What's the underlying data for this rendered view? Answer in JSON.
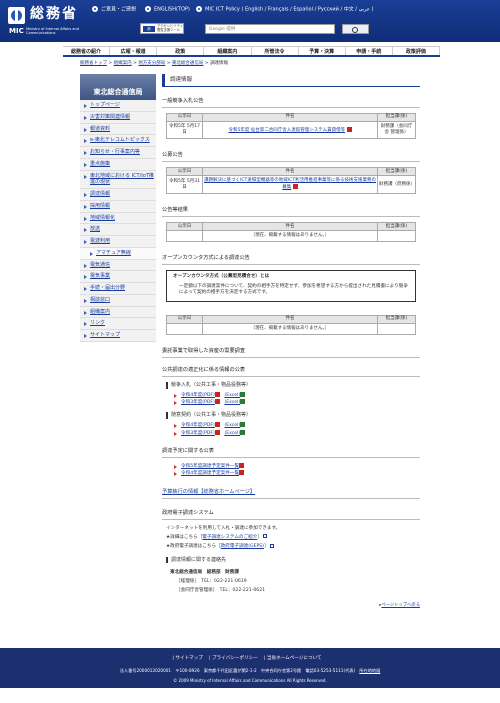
{
  "header": {
    "logo_ja": "総務省",
    "logo_mic": "MIC",
    "logo_en": "Ministry of Internal Affairs and Communications",
    "link1": "ご意見・ご感想",
    "link2": "ENGLISH(TOP)",
    "link3": "MIC ICT Policy ( English / Français / Español / Русский / 中文 / عربي )",
    "font_label": "アクセシビリティ閲覧支援ツール",
    "search_placeholder": "Google 提供"
  },
  "nav": [
    "総務省の紹介",
    "広報・報道",
    "政策",
    "組織案内",
    "所管法令",
    "予算・決算",
    "申請・手続",
    "政策評価"
  ],
  "breadcrumb": [
    "総務省トップ",
    "組織案内",
    "地方支分部局",
    "東北総合通信局",
    "調達情報"
  ],
  "sidebar": {
    "title": "東北総合通信局",
    "items": [
      "トップページ",
      "災害対策関連情報",
      "報道資料",
      "e-東北テレコムトピックス",
      "お知らせ・行事案内等",
      "重点施策",
      "東北地域における ICT/IoT推進の現状",
      "調達情報",
      "採用情報",
      "地域情報化",
      "放送",
      "電波利用",
      "アマチュア無線",
      "電気通信",
      "電気事業",
      "手続・届出分野",
      "相談窓口",
      "組織案内",
      "リンク",
      "サイトマップ"
    ]
  },
  "main": {
    "title": "調達情報",
    "s1": {
      "heading": "一般競争入札公告",
      "cols": [
        "公示日",
        "件名",
        "担当課(係)"
      ],
      "date": "令和5年 5月17日",
      "subject": "令和5年度 仙台第二合同庁舎入退館管理システム賃貸借等",
      "dept": "財務課（会同庁舎 管理係）"
    },
    "s2": {
      "heading": "公募公告",
      "cols": [
        "公示日",
        "件名",
        "担当課(係)"
      ],
      "date": "令和5年 5月31日",
      "subject": "課題解決に基づくICT遠隔型機器等の地域ICT利活用推進事業等に係る技術支援業務の募集",
      "dept": "財務課（庶務係）"
    },
    "s3": {
      "heading": "公告等結果",
      "cols": [
        "公示日",
        "件名",
        "担当課(係)"
      ],
      "none": "（現在、掲載する情報はありません。）"
    },
    "s4": {
      "heading": "オープンカウンタ方式による調達公告",
      "box_title": "オープンカウンタ方式（公募型見積合せ）とは",
      "box_body": "一定額以下の調達案件について、契約の相手方を特定せず、参加を希望する方から提出された見積書により競争によって契約の相手方を決定する方式です。",
      "cols": [
        "公示日",
        "件名",
        "担当課(係)"
      ],
      "none": "（現在、掲載する情報はありません。）"
    },
    "s5": {
      "heading": "委託事業で取得した資産の需要調査"
    },
    "s6": {
      "heading": "公共調達の適正化に係る情報の公表",
      "sub1": "競争入札（公共工事・物品役務等）",
      "l1a": "令和4年度(PDF)",
      "l1b": "令和3年度(PDF)",
      "excel": "(Excel)",
      "sub2": "随意契約（公共工事・物品役務等）",
      "l2a": "令和4年度(PDF)",
      "l2b": "令和3年度(PDF)"
    },
    "s7": {
      "heading": "調達予定に関する公表",
      "l1": "令和5年度調達予定案件一覧",
      "l2": "令和4年度調達予定案件一覧"
    },
    "s8": {
      "heading": "予算執行の情報【総務省ホームページ】"
    },
    "s9": {
      "heading": "政府電子調達システム",
      "p1": "インターネットを利用して入札・調達に参加できます。",
      "p2": "★詳細はこちら",
      "link2": "電子調達システムのご紹介",
      "p3": "★政府電子調達はこちら",
      "link3": "政府電子調達(GEPS)"
    },
    "s10": {
      "heading": "調達情報に関する連絡先",
      "org": "東北総合通信局　総務部　財務課",
      "tel1": "［経理係］　TEL：022-221-0619",
      "tel2": "［会同庁舎管理係］　TEL：022-221-0621"
    },
    "pagetop": "ページトップへ戻る"
  },
  "footer": {
    "nav": [
      "サイトマップ",
      "プライバシーポリシー",
      "当省ホームページについて"
    ],
    "address": "法人番号2000012020001　〒100-8926　東京都千代田区霞が関2-1-2　中央合同庁舎第2号館　電話03-5253-5111(代表)",
    "access": "所在地地図",
    "copyright": "© 2009 Ministry of Internal Affairs and Communications All Rights Reserved."
  }
}
